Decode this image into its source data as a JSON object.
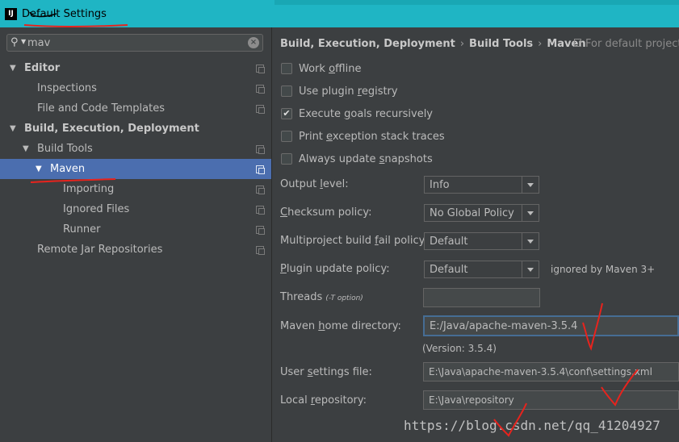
{
  "window": {
    "title": "Default Settings",
    "logo_text": "IJ"
  },
  "search": {
    "value": "mav",
    "placeholder": ""
  },
  "tree": {
    "editor": "Editor",
    "inspections": "Inspections",
    "file_templates": "File and Code Templates",
    "build_exec": "Build, Execution, Deployment",
    "build_tools": "Build Tools",
    "maven": "Maven",
    "importing": "Importing",
    "ignored_files": "Ignored Files",
    "runner": "Runner",
    "remote_jar": "Remote Jar Repositories"
  },
  "breadcrumb": {
    "part1": "Build, Execution, Deployment",
    "sep": "›",
    "part2": "Build Tools",
    "part3": "Maven",
    "default_project": "For default project"
  },
  "checkboxes": {
    "work_offline": {
      "pre": "Work ",
      "u": "o",
      "post": "ffline",
      "checked": false
    },
    "plugin_registry": {
      "pre": "Use plugin ",
      "u": "r",
      "post": "egistry",
      "checked": false
    },
    "execute_goals": {
      "pre": "Execute ",
      "u": "g",
      "post": "oals recursively",
      "checked": true
    },
    "print_exception": {
      "pre": "Print ",
      "u": "e",
      "post": "xception stack traces",
      "checked": false
    },
    "update_snapshots": {
      "pre": "Always update ",
      "u": "s",
      "post": "napshots",
      "checked": false
    }
  },
  "fields": {
    "output_level": {
      "pre": "Output ",
      "u": "l",
      "post": "evel:",
      "value": "Info"
    },
    "checksum": {
      "pre": "",
      "u": "C",
      "post": "hecksum policy:",
      "value": "No Global Policy"
    },
    "multiproject": {
      "pre": "Multiproject build ",
      "u": "f",
      "post": "ail policy:",
      "value": "Default"
    },
    "plugin_update": {
      "pre": "",
      "u": "P",
      "post": "lugin update policy:",
      "value": "Default",
      "note": "ignored by Maven 3+"
    },
    "threads": {
      "label": "Threads",
      "hint": "(-T option)",
      "value": ""
    },
    "maven_home": {
      "pre": "Maven ",
      "u": "h",
      "post": "ome directory:",
      "value": "E:/Java/apache-maven-3.5.4",
      "version": "(Version: 3.5.4)"
    },
    "user_settings": {
      "pre": "User ",
      "u": "s",
      "post": "ettings file:",
      "value": "E:\\Java\\apache-maven-3.5.4\\conf\\settings.xml"
    },
    "local_repo": {
      "pre": "Local ",
      "u": "r",
      "post": "epository:",
      "value": "E:\\Java\\repository"
    }
  },
  "watermark": "https://blog.csdn.net/qq_41204927",
  "colors": {
    "titlebar": "#1fb5c4",
    "selection": "#4b6eaf",
    "annotation": "#e8231d"
  }
}
